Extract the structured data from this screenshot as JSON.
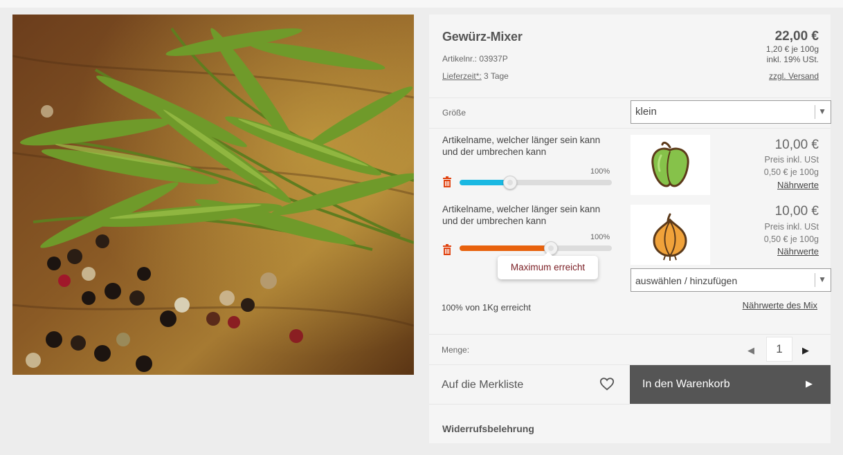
{
  "product": {
    "title": "Gewürz-Mixer",
    "article_number": "Artikelnr.: 03937P",
    "delivery_label": "Lieferzeit*:",
    "delivery_value": "3 Tage",
    "price": "22,00 €",
    "unit_price": "1,20 € je 100g",
    "vat": "inkl. 19% USt.",
    "shipping": "zzgl. Versand"
  },
  "size": {
    "label": "Größe",
    "selected": "klein"
  },
  "items": [
    {
      "name": "Artikelname, welcher länger sein kann und der umbrechen kann",
      "percent_label": "100%",
      "slider_fraction": 0.33,
      "slider_color": "#1ab8e2",
      "price": "10,00 €",
      "price_note": "Preis inkl. USt",
      "unit_price": "0,50 € je 100g",
      "nutrition": "Nährwerte",
      "icon": "pepper-icon"
    },
    {
      "name": "Artikelname, welcher länger sein kann und der umbrechen kann",
      "percent_label": "100%",
      "slider_fraction": 0.6,
      "slider_color": "#e8620d",
      "price": "10,00 €",
      "price_note": "Preis inkl. USt",
      "unit_price": "0,50 € je 100g",
      "nutrition": "Nährwerte",
      "icon": "onion-icon"
    }
  ],
  "tooltip": "Maximum erreicht",
  "add_select": "auswählen / hinzufügen",
  "summary": {
    "percent": "100%",
    "text": "von 1Kg erreicht",
    "mix_nutrition": "Nährwerte des Mix"
  },
  "quantity": {
    "label": "Menge:",
    "value": "1"
  },
  "wishlist": "Auf die Merkliste",
  "cart_button": "In den Warenkorb",
  "withdrawal": "Widerrufsbelehrung",
  "colors": {
    "cart_bg": "#555555",
    "tooltip_text": "#7b1f25",
    "trash": "#e0420f"
  }
}
